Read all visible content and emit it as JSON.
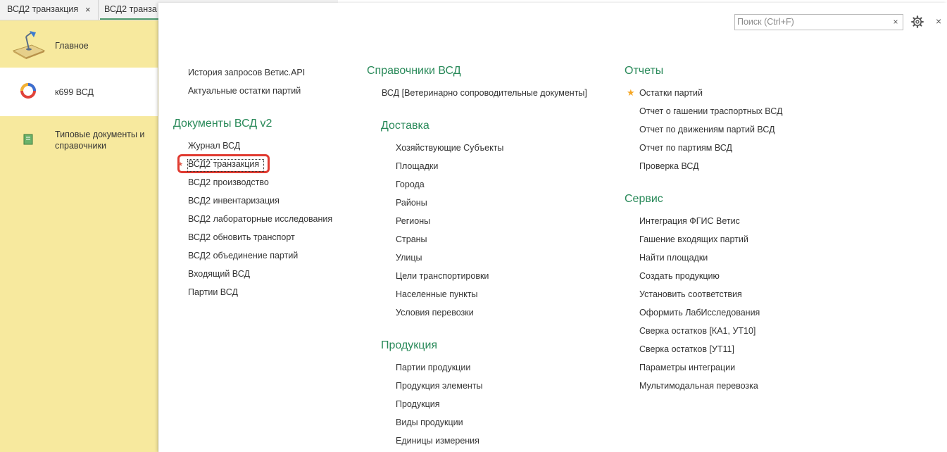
{
  "tabs": [
    {
      "label": "ВСД2 транзакция",
      "close": "×"
    },
    {
      "label": "ВСД2 транза"
    }
  ],
  "sidebar": {
    "items": [
      {
        "label": "Главное"
      },
      {
        "label": "к699 ВСД"
      },
      {
        "label": "Типовые документы и справочники"
      }
    ]
  },
  "search": {
    "placeholder": "Поиск (Ctrl+F)",
    "value": "",
    "clear": "×"
  },
  "close_label": "×",
  "columns": {
    "col1": {
      "top_links": [
        "История запросов Ветис.API",
        "Актуальные остатки партий"
      ],
      "group_title": "Документы ВСД v2",
      "items": [
        "Журнал ВСД",
        "ВСД2 транзакция",
        "ВСД2 производство",
        "ВСД2 инвентаризация",
        "ВСД2 лабораторные исследования",
        "ВСД2 обновить транспорт",
        "ВСД2 объединение партий",
        "Входящий ВСД",
        "Партии ВСД"
      ]
    },
    "col2": {
      "group1_title": "Справочники ВСД",
      "group1_items": [
        "ВСД [Ветеринарно сопроводительные документы]"
      ],
      "group2_title": "Доставка",
      "group2_items": [
        "Хозяйствующие Субъекты",
        "Площадки",
        "Города",
        "Районы",
        "Регионы",
        "Страны",
        "Улицы",
        "Цели транспортировки",
        "Населенные пункты",
        "Условия перевозки"
      ],
      "group3_title": "Продукция",
      "group3_items": [
        "Партии продукции",
        "Продукция элементы",
        "Продукция",
        "Виды продукции",
        "Единицы измерения"
      ]
    },
    "col3": {
      "group1_title": "Отчеты",
      "group1_items": [
        "Остатки партий",
        "Отчет о гашении траспортных ВСД",
        "Отчет по движениям партий ВСД",
        "Отчет по партиям ВСД",
        "Проверка ВСД"
      ],
      "group2_title": "Сервис",
      "group2_items": [
        "Интеграция ФГИС Ветис",
        "Гашение входящих партий",
        "Найти площадки",
        "Создать продукцию",
        "Установить соответствия",
        "Оформить ЛабИсследования",
        "Сверка остатков [КА1, УТ10]",
        "Сверка остатков [УТ11]",
        "Параметры интеграции",
        "Мультимодальная перевозка"
      ]
    }
  },
  "colors": {
    "accent_green": "#2a8a5a",
    "sidebar_bg": "#f7e99e",
    "highlight_red": "#e03a30",
    "star": "#f5a623"
  }
}
